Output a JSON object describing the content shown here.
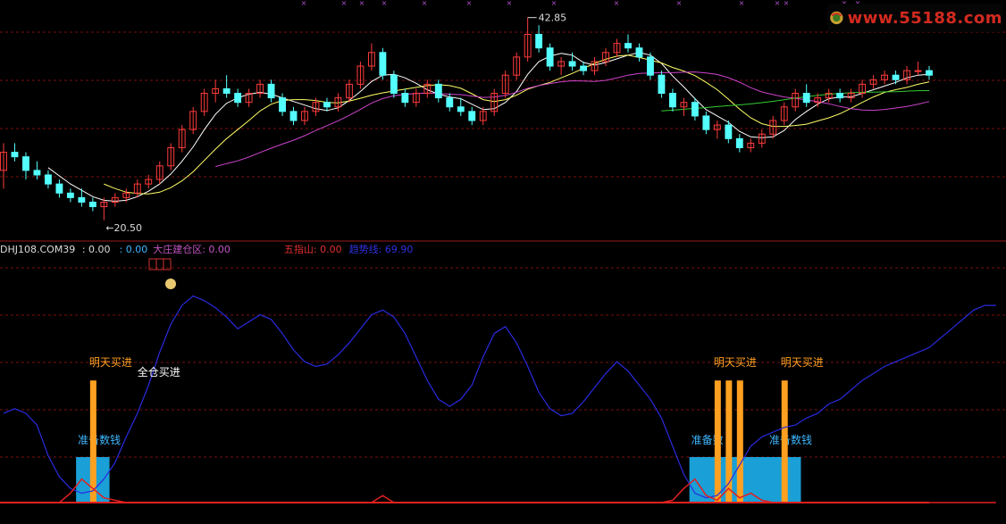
{
  "watermark": {
    "text": "www.55188.com"
  },
  "header": {
    "prefix": "DHJ108.COM39",
    "fields": [
      {
        "label": "",
        "value": ": 0.00",
        "color": "#dcdcdc"
      },
      {
        "label": "",
        "value": ": 0.00",
        "color": "#3fb7ff"
      },
      {
        "label": "大庄建仓区",
        "value": ": 0.00",
        "color": "#c455c4"
      },
      {
        "label": "五指山",
        "value": ": 0.00",
        "color": "#e03030"
      },
      {
        "label": "趋势线",
        "value": ": 69.90",
        "color": "#3030e0"
      }
    ]
  },
  "chart_data": {
    "type": "candlestick_with_indicator",
    "price_panel": {
      "ylim": [
        19,
        44
      ],
      "high_label": "42.85",
      "low_label": "20.50",
      "candles": [
        [
          26,
          29,
          24,
          28
        ],
        [
          28,
          29,
          27,
          27.5
        ],
        [
          27.5,
          28,
          25,
          26
        ],
        [
          26,
          27,
          25,
          25.5
        ],
        [
          25.5,
          26,
          24,
          24.5
        ],
        [
          24.5,
          25,
          23,
          23.5
        ],
        [
          23.5,
          24,
          22.5,
          23
        ],
        [
          23,
          24,
          22,
          22.5
        ],
        [
          22.5,
          23,
          21.5,
          22
        ],
        [
          22,
          23,
          20.5,
          22.5
        ],
        [
          22.5,
          23.5,
          22,
          23
        ],
        [
          23,
          24,
          22.5,
          23.5
        ],
        [
          23.5,
          25,
          23,
          24.5
        ],
        [
          24.5,
          25.5,
          24,
          25
        ],
        [
          25,
          27,
          24.5,
          26.5
        ],
        [
          26.5,
          29,
          26,
          28.5
        ],
        [
          28.5,
          31,
          28,
          30.5
        ],
        [
          30.5,
          33,
          30,
          32.5
        ],
        [
          32.5,
          35,
          32,
          34.5
        ],
        [
          34.5,
          36,
          33.5,
          35
        ],
        [
          35,
          36.5,
          34,
          34.5
        ],
        [
          34.5,
          35,
          33,
          33.5
        ],
        [
          33.5,
          35,
          33,
          34.5
        ],
        [
          34.5,
          36,
          34,
          35.5
        ],
        [
          35.5,
          36,
          33.5,
          34
        ],
        [
          34,
          34.5,
          32,
          32.5
        ],
        [
          32.5,
          33,
          31,
          31.5
        ],
        [
          31.5,
          33,
          31,
          32.5
        ],
        [
          32.5,
          34,
          32,
          33.5
        ],
        [
          33.5,
          34,
          32.5,
          33
        ],
        [
          33,
          34.5,
          32.5,
          34
        ],
        [
          34,
          36,
          33.5,
          35.5
        ],
        [
          35.5,
          38,
          35,
          37.5
        ],
        [
          37.5,
          40,
          37,
          39
        ],
        [
          39,
          39.5,
          36,
          36.5
        ],
        [
          36.5,
          37,
          34,
          34.5
        ],
        [
          34.5,
          35,
          33,
          33.5
        ],
        [
          33.5,
          35,
          33,
          34.5
        ],
        [
          34.5,
          36,
          34,
          35.5
        ],
        [
          35.5,
          36,
          33.5,
          34
        ],
        [
          34,
          34.5,
          32.5,
          33
        ],
        [
          33,
          34,
          32,
          32.5
        ],
        [
          32.5,
          33,
          31,
          31.5
        ],
        [
          31.5,
          33,
          31,
          32.5
        ],
        [
          32.5,
          35,
          32,
          34.5
        ],
        [
          34.5,
          37,
          34,
          36.5
        ],
        [
          36.5,
          39,
          36,
          38.5
        ],
        [
          38.5,
          42.85,
          38,
          41
        ],
        [
          41,
          42,
          39,
          39.5
        ],
        [
          39.5,
          40,
          37,
          37.5
        ],
        [
          37.5,
          38.5,
          36.5,
          38
        ],
        [
          38,
          39,
          37,
          37.5
        ],
        [
          37.5,
          38,
          36.5,
          37
        ],
        [
          37,
          38.5,
          36.5,
          38
        ],
        [
          38,
          39.5,
          37.5,
          39
        ],
        [
          39,
          40.5,
          38.5,
          40
        ],
        [
          40,
          41,
          39,
          39.5
        ],
        [
          39.5,
          40,
          38,
          38.5
        ],
        [
          38.5,
          39,
          36,
          36.5
        ],
        [
          36.5,
          37,
          34,
          34.5
        ],
        [
          34.5,
          35,
          32.5,
          33
        ],
        [
          33,
          34,
          32,
          33.5
        ],
        [
          33.5,
          34,
          31.5,
          32
        ],
        [
          32,
          32.5,
          30,
          30.5
        ],
        [
          30.5,
          31.5,
          29.5,
          31
        ],
        [
          31,
          31.5,
          29,
          29.5
        ],
        [
          29.5,
          30,
          28,
          28.5
        ],
        [
          28.5,
          29.5,
          28,
          29
        ],
        [
          29,
          30.5,
          28.5,
          30
        ],
        [
          30,
          32,
          29.5,
          31.5
        ],
        [
          31.5,
          33.5,
          31,
          33
        ],
        [
          33,
          35,
          32.5,
          34.5
        ],
        [
          34.5,
          35.5,
          33,
          33.5
        ],
        [
          33.5,
          34.5,
          33,
          34
        ],
        [
          34,
          35,
          33.5,
          34.5
        ],
        [
          34.5,
          35,
          33.5,
          34
        ],
        [
          34,
          35,
          33.5,
          34.5
        ],
        [
          34.5,
          36,
          34,
          35.5
        ],
        [
          35.5,
          36.5,
          35,
          36
        ],
        [
          36,
          37,
          35.5,
          36.5
        ],
        [
          36.5,
          37,
          35.5,
          36
        ],
        [
          36,
          37.5,
          35.5,
          37
        ],
        [
          37,
          38,
          36.5,
          37
        ],
        [
          37,
          37.5,
          36,
          36.5
        ]
      ],
      "ma_lines": [
        {
          "name": "MA5",
          "color": "#ffffff",
          "period": 5
        },
        {
          "name": "MA10",
          "color": "#ffff66",
          "period": 10
        },
        {
          "name": "MA20",
          "color": "#cc44cc",
          "period": 20
        },
        {
          "name": "MA60",
          "color": "#33cc33",
          "period": 60
        }
      ]
    },
    "indicator_panel": {
      "ylim": [
        0,
        100
      ],
      "trend_line": [
        38,
        40,
        38,
        33,
        20,
        11,
        6,
        4,
        5,
        10,
        17,
        28,
        38,
        50,
        64,
        76,
        84,
        88,
        86,
        83,
        79,
        74,
        77,
        80,
        78,
        72,
        65,
        60,
        58,
        59,
        63,
        68,
        74,
        80,
        82,
        79,
        72,
        62,
        52,
        44,
        41,
        44,
        50,
        62,
        72,
        75,
        68,
        58,
        47,
        40,
        37,
        38,
        43,
        49,
        55,
        60,
        56,
        50,
        44,
        36,
        24,
        12,
        4,
        2,
        3,
        8,
        16,
        24,
        28,
        30,
        32,
        33,
        36,
        38,
        42,
        44,
        48,
        52,
        55,
        58,
        60,
        62,
        64,
        66,
        70,
        74,
        78,
        82,
        84,
        84
      ],
      "fivefinger_line": [
        0,
        0,
        0,
        0,
        0,
        0,
        4,
        10,
        6,
        2,
        1,
        0,
        0,
        0,
        0,
        0,
        0,
        0,
        0,
        0,
        0,
        0,
        0,
        0,
        0,
        0,
        0,
        0,
        0,
        0,
        0,
        0,
        0,
        0,
        3,
        0,
        0,
        0,
        0,
        0,
        0,
        0,
        0,
        0,
        0,
        0,
        0,
        0,
        0,
        0,
        0,
        0,
        0,
        0,
        0,
        0,
        0,
        0,
        0,
        0,
        1,
        6,
        10,
        3,
        1,
        6,
        2,
        4,
        1,
        0,
        0,
        0,
        0,
        0,
        0,
        0,
        0,
        0,
        0,
        0,
        0,
        0,
        0,
        0,
        0,
        0,
        0,
        0,
        0,
        0
      ],
      "prep_zones": [
        {
          "start": 7,
          "end": 9,
          "label": "准备数钱"
        },
        {
          "start": 62,
          "end": 69,
          "label": "准备数"
        },
        {
          "start": 69,
          "end": 71,
          "label": "准备数钱"
        }
      ],
      "buy_bars": [
        {
          "index": 8,
          "height": 26,
          "label": "明天买进"
        },
        {
          "index": 64,
          "height": 26,
          "label": "明天买进"
        },
        {
          "index": 65,
          "height": 26,
          "label": ""
        },
        {
          "index": 66,
          "height": 26,
          "label": ""
        },
        {
          "index": 70,
          "height": 26,
          "label": "明天买进"
        }
      ],
      "annotations": [
        {
          "index": 12,
          "value": 24,
          "label": "全仓买进"
        }
      ]
    }
  }
}
